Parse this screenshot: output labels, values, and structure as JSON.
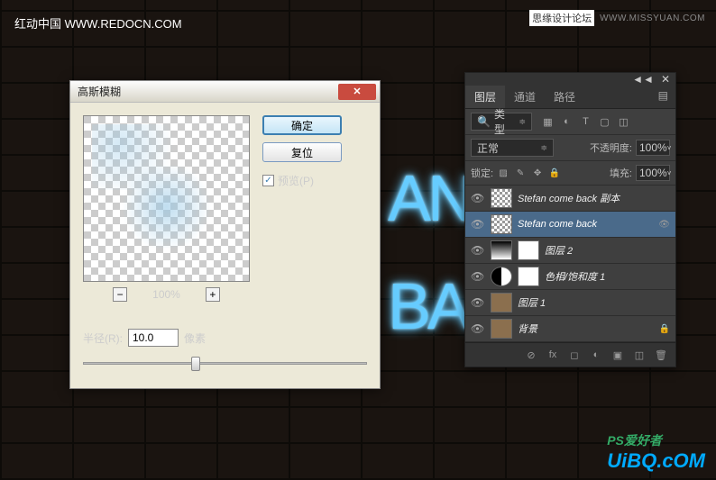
{
  "watermarks": {
    "top_left": "红动中国 WWW.REDOCN.COM",
    "top_right_cn": "思缘设计论坛",
    "top_right_en": "WWW.MISSYUAN.COM",
    "bottom_right_ps": "PS爱好者",
    "bottom_right_uibq": "UiBQ.cOM"
  },
  "neon": {
    "part1": "AN",
    "part2": "BA"
  },
  "dialog": {
    "title": "高斯模糊",
    "ok": "确定",
    "reset": "复位",
    "preview_label": "预览(P)",
    "zoom_pct": "100%",
    "radius_label": "半径(R):",
    "radius_value": "10.0",
    "radius_unit": "像素"
  },
  "panel": {
    "tabs": [
      "图层",
      "通道",
      "路径"
    ],
    "filter_label": "类型",
    "blend_mode": "正常",
    "opacity_label": "不透明度:",
    "opacity_value": "100%",
    "lock_label": "锁定:",
    "fill_label": "填充:",
    "fill_value": "100%",
    "layers": [
      {
        "name": "Stefan  come back 副本",
        "thumb": "checker"
      },
      {
        "name": "Stefan  come back",
        "thumb": "checker",
        "selected": true,
        "fx": true
      },
      {
        "name": "图层 2",
        "thumb": "bw",
        "mask": true
      },
      {
        "name": "色相/饱和度 1",
        "thumb": "adj",
        "mask": true
      },
      {
        "name": "图层 1",
        "thumb": "tex"
      },
      {
        "name": "背景",
        "thumb": "tex",
        "locked": true
      }
    ]
  }
}
